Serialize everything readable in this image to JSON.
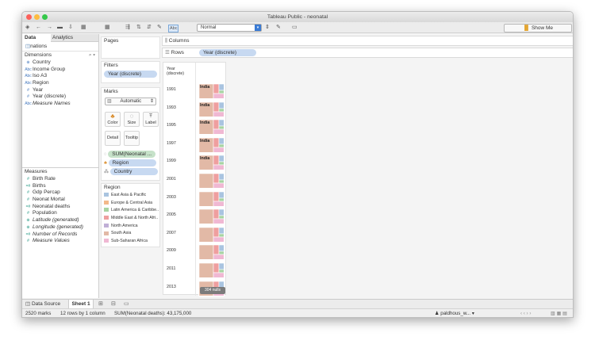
{
  "window": {
    "title": "Tableau Public - neonatal",
    "traffic": [
      "#fc605b",
      "#fdbc40",
      "#34c84a"
    ]
  },
  "toolbar": {
    "icons": [
      "◈",
      "←",
      "→",
      "▬",
      "⇩",
      "▦",
      "▦",
      "⇶",
      "⇅",
      "⇵",
      "✎",
      "Abc",
      "⇕",
      "▭"
    ],
    "format_value": "Normal",
    "show_me": "Show Me"
  },
  "left": {
    "tabs": [
      "Data",
      "Analytics"
    ],
    "datasource": "nations",
    "dimensions_title": "Dimensions",
    "dimensions": [
      {
        "icon": "⊕",
        "label": "Country",
        "italic": false
      },
      {
        "icon": "Abc",
        "label": "Income Group",
        "italic": false
      },
      {
        "icon": "Abc",
        "label": "Iso A3",
        "italic": false
      },
      {
        "icon": "Abc",
        "label": "Region",
        "italic": false
      },
      {
        "icon": "#",
        "label": "Year",
        "italic": false
      },
      {
        "icon": "#",
        "label": "Year (discrete)",
        "italic": false
      },
      {
        "icon": "Abc",
        "label": "Measure Names",
        "italic": true
      }
    ],
    "measures_title": "Measures",
    "measures": [
      {
        "icon": "#",
        "label": "Birth Rate",
        "italic": false
      },
      {
        "icon": "=#",
        "label": "Births",
        "italic": false
      },
      {
        "icon": "#",
        "label": "Gdp Percap",
        "italic": false
      },
      {
        "icon": "#",
        "label": "Neonat Mortal",
        "italic": false
      },
      {
        "icon": "=#",
        "label": "Neonatal deaths",
        "italic": false
      },
      {
        "icon": "#",
        "label": "Population",
        "italic": false
      },
      {
        "icon": "⊕",
        "label": "Latitude (generated)",
        "italic": true
      },
      {
        "icon": "⊕",
        "label": "Longitude (generated)",
        "italic": true
      },
      {
        "icon": "=#",
        "label": "Number of Records",
        "italic": true
      },
      {
        "icon": "#",
        "label": "Measure Values",
        "italic": true
      }
    ]
  },
  "pages": {
    "title": "Pages"
  },
  "filters": {
    "title": "Filters",
    "pill": "Year (discrete)"
  },
  "marks": {
    "title": "Marks",
    "type": "Automatic",
    "buttons": [
      "Color",
      "Size",
      "Label",
      "Detail",
      "Tooltip"
    ],
    "pills": [
      "SUM(Neonatal ...",
      "Region",
      "Country"
    ]
  },
  "legend": {
    "title": "Region",
    "items": [
      {
        "label": "East Asia & Pacific",
        "color": "#a9c4e0"
      },
      {
        "label": "Europe & Central Asia",
        "color": "#f3b98a"
      },
      {
        "label": "Latin America & Caribbe..",
        "color": "#a7d4a2"
      },
      {
        "label": "Middle East & North Afri..",
        "color": "#ef9f9f"
      },
      {
        "label": "North America",
        "color": "#c0afd6"
      },
      {
        "label": "South Asia",
        "color": "#e2b9a6"
      },
      {
        "label": "Sub-Saharan Africa",
        "color": "#f0b8d3"
      }
    ]
  },
  "shelves": {
    "columns": "Columns",
    "rows": "Rows",
    "rows_pill": "Year (discrete)"
  },
  "view": {
    "header": "Year\n(discrete)",
    "years": [
      "1991",
      "1993",
      "1995",
      "1997",
      "1999",
      "2001",
      "2003",
      "2005",
      "2007",
      "2009",
      "2011",
      "2013"
    ],
    "cell_label": "India",
    "labeled_count": 5,
    "nulls": "304 nulls"
  },
  "sheets": {
    "data_source": "Data Source",
    "sheet": "Sheet 1"
  },
  "status": {
    "marks": "2520 marks",
    "rows": "12 rows by 1 column",
    "sum": "SUM(Neonatal deaths): 43,175,000",
    "user": "paldhous_w..."
  }
}
